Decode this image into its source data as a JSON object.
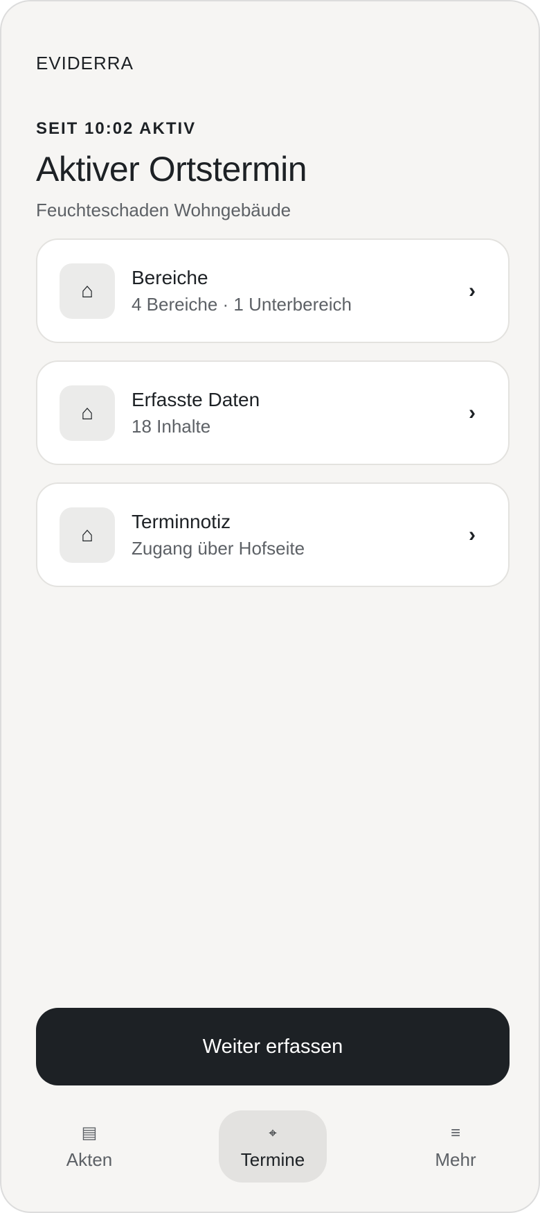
{
  "app": {
    "brand": "EVIDERRA"
  },
  "header": {
    "eyebrow": "SEIT 10:02 AKTIV",
    "title": "Aktiver Ortstermin",
    "subtitle": "Feuchteschaden Wohngebäude"
  },
  "cards": [
    {
      "icon": "⌂",
      "icon_name": "home-icon",
      "title": "Bereiche",
      "subtitle": "4 Bereiche · 1 Unterbereich",
      "chevron": "›"
    },
    {
      "icon": "⌂",
      "icon_name": "home-icon",
      "title": "Erfasste Daten",
      "subtitle": "18 Inhalte",
      "chevron": "›"
    },
    {
      "icon": "⌂",
      "icon_name": "home-icon",
      "title": "Terminnotiz",
      "subtitle": "Zugang über Hofseite",
      "chevron": "›"
    }
  ],
  "cta": {
    "label": "Weiter erfassen"
  },
  "nav": [
    {
      "icon": "▤",
      "icon_name": "folder-list-icon",
      "label": "Akten",
      "active": false
    },
    {
      "icon": "⌖",
      "icon_name": "crosshair-icon",
      "label": "Termine",
      "active": true
    },
    {
      "icon": "≡",
      "icon_name": "menu-icon",
      "label": "Mehr",
      "active": false
    }
  ],
  "colors": {
    "background": "#f6f5f3",
    "primary": "#1d2125",
    "muted": "#5d6166",
    "card": "#ffffff"
  }
}
